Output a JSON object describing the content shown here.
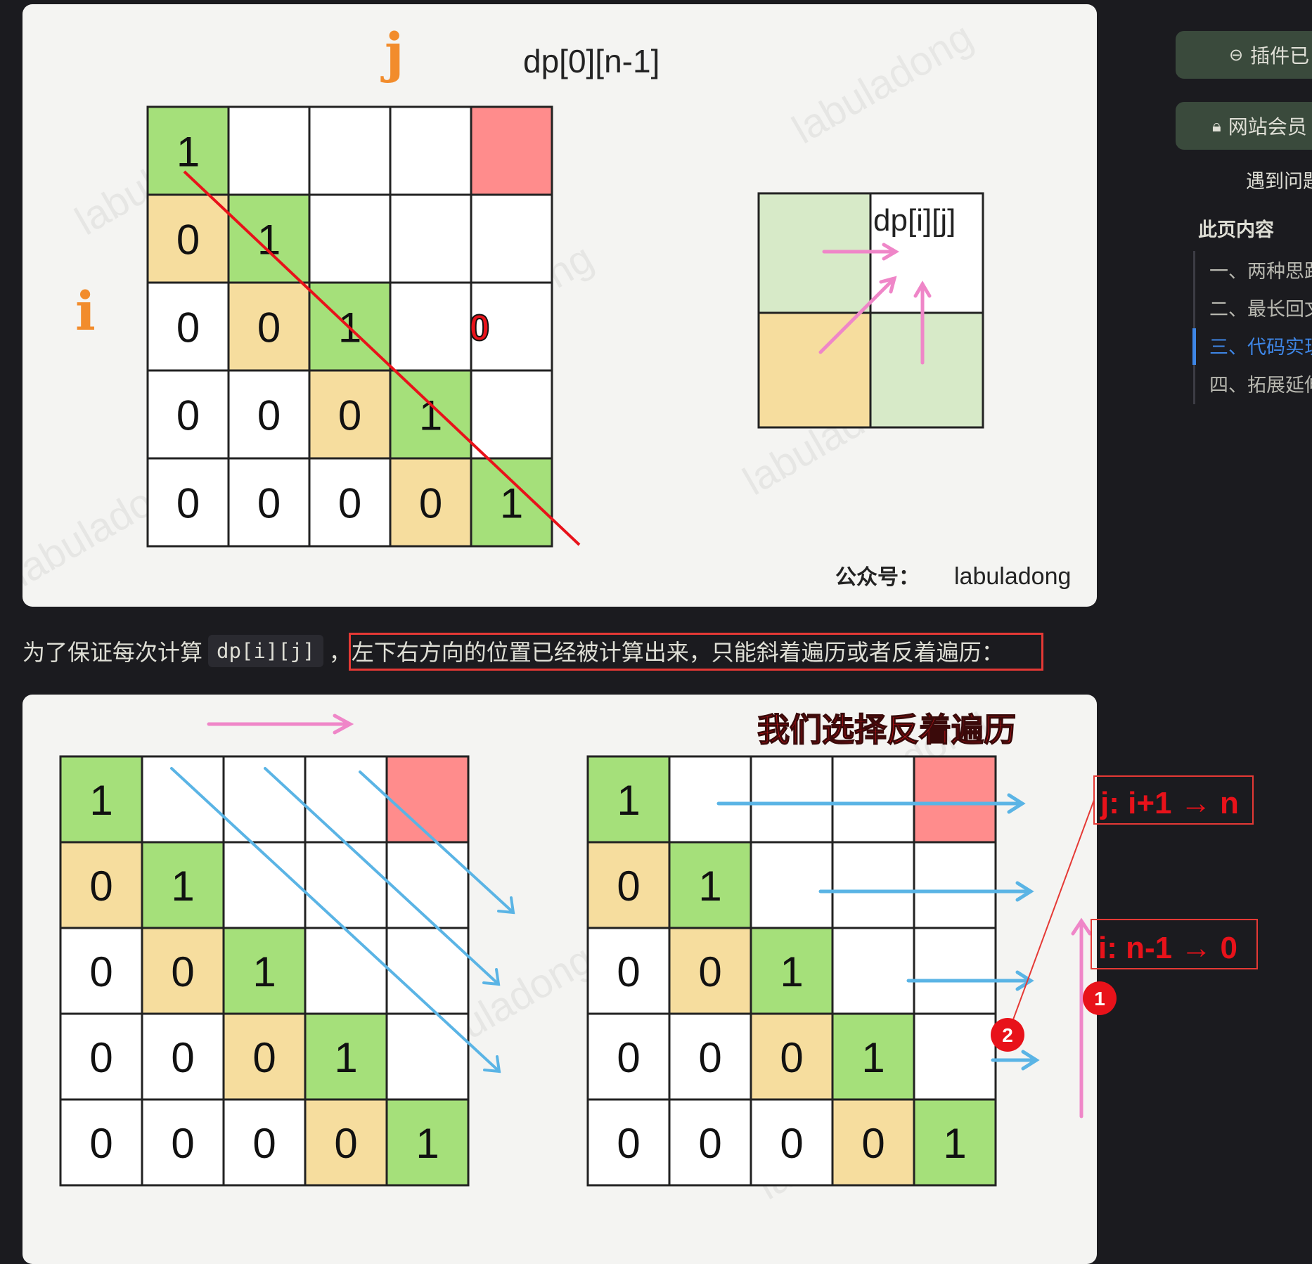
{
  "figure1": {
    "top_label": "dp[0][n-1]",
    "j_label": "j",
    "i_label": "i",
    "matrix": [
      [
        "1",
        "",
        "",
        "",
        ""
      ],
      [
        "0",
        "1",
        "",
        "",
        ""
      ],
      [
        "0",
        "0",
        "1",
        "0",
        ""
      ],
      [
        "0",
        "0",
        "0",
        "1",
        ""
      ],
      [
        "0",
        "0",
        "0",
        "0",
        "1"
      ]
    ],
    "highlight_zero": "0",
    "mini_label": "dp[i][j]",
    "footer_label": "labuladong",
    "watermark": "labuladong"
  },
  "caption": {
    "prefix": "为了保证每次计算",
    "code": "dp[i][j]",
    "highlighted": "，左下右方向的位置已经被计算出来，只能斜着遍历或者反着遍历："
  },
  "figure2": {
    "title": "我们选择反着遍历",
    "left_matrix": [
      [
        "1",
        "",
        "",
        "",
        ""
      ],
      [
        "0",
        "1",
        "",
        "",
        ""
      ],
      [
        "0",
        "0",
        "1",
        "",
        ""
      ],
      [
        "0",
        "0",
        "0",
        "1",
        ""
      ],
      [
        "0",
        "0",
        "0",
        "0",
        "1"
      ]
    ],
    "right_matrix": [
      [
        "1",
        "",
        "",
        "",
        ""
      ],
      [
        "0",
        "1",
        "",
        "",
        ""
      ],
      [
        "0",
        "0",
        "1",
        "",
        ""
      ],
      [
        "0",
        "0",
        "0",
        "1",
        ""
      ],
      [
        "0",
        "0",
        "0",
        "0",
        "1"
      ]
    ],
    "annotation_j": "j:  i+1 → n",
    "annotation_i": "i:  n-1 → 0",
    "badge1": "1",
    "badge2": "2",
    "watermark": "labuladong"
  },
  "sidebar": {
    "button1_label": "插件已",
    "button1_icon": "link-icon",
    "button2_label": "网站会员",
    "button2_icon": "lock-icon",
    "help_text": "遇到问题",
    "toc_title": "此页内容",
    "toc_items": [
      "一、两种思路",
      "二、最长回文",
      "三、代码实现",
      "四、拓展延伸"
    ],
    "toc_active_index": 2
  },
  "colors": {
    "green_cell": "#a5e07a",
    "yellow_cell": "#f6dd9e",
    "red_cell": "#ff8c8c",
    "blue_arrow": "#5ab4e5",
    "pink_arrow": "#ef86c8",
    "red_line": "#e8121a",
    "accent": "#3e86e6"
  }
}
